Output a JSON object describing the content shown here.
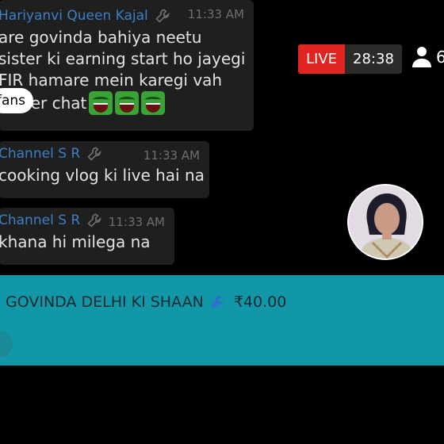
{
  "chat": {
    "messages": [
      {
        "sender": "Hariyanvi Queen Kajal",
        "time": "11:33 AM",
        "lines": [
          "are govinda bahiya neetu",
          "sister ki earning start ho jayegi",
          "FIR hamare mein karegi vah"
        ],
        "tail": "per chat",
        "fans_label": "fans",
        "emoji": "laughing-emoji"
      },
      {
        "sender": "Channel S R",
        "time": "11:33 AM",
        "text": "cooking vlog ki live hai na"
      },
      {
        "sender": "Channel S R",
        "time": "11:33 AM",
        "text": "khana hi milega na"
      }
    ]
  },
  "live": {
    "label": "LIVE",
    "duration": "28:38",
    "viewers": "6"
  },
  "super_chat": {
    "name": "GOVINDA DELHI KI SHAAN",
    "amount": "₹40.00",
    "color": "#1297a8"
  },
  "colors": {
    "sender": "#3b7fc4",
    "live": "#e0241f"
  }
}
